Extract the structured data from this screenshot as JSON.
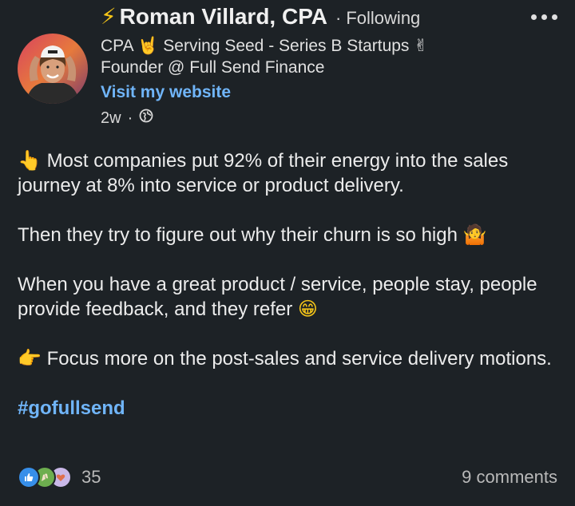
{
  "author": {
    "emoji": "⚡",
    "name": "Roman Villard, CPA",
    "follow_status": "Following",
    "headline_line1": "CPA 🤘 Serving Seed - Series B Startups ✌",
    "headline_line2": "Founder @ Full Send Finance",
    "website_label": "Visit my website",
    "time": "2w"
  },
  "post": {
    "paragraph1_emoji": "👆",
    "paragraph1": "Most companies put 92% of their energy into the sales journey at 8% into service or product delivery.",
    "paragraph2": "Then they try to figure out why their churn is so high",
    "paragraph2_emoji": "🤷",
    "paragraph3": "When you have a great product / service, people stay, people provide feedback, and they refer",
    "paragraph3_emoji": "😁",
    "paragraph4_emoji": "👉",
    "paragraph4": "Focus more on the post-sales and service delivery motions.",
    "hashtag": "#gofullsend"
  },
  "social": {
    "reaction_count": "35",
    "comments": "9 comments"
  },
  "colors": {
    "background": "#1d2226",
    "link": "#70b5f9",
    "like": "#378fe9",
    "celebrate": "#6dae4f",
    "love": "#df704d"
  },
  "icons": {
    "more": "more-options-icon",
    "globe": "globe-icon",
    "like": "like-reaction-icon",
    "celebrate": "celebrate-reaction-icon",
    "love": "love-reaction-icon"
  }
}
